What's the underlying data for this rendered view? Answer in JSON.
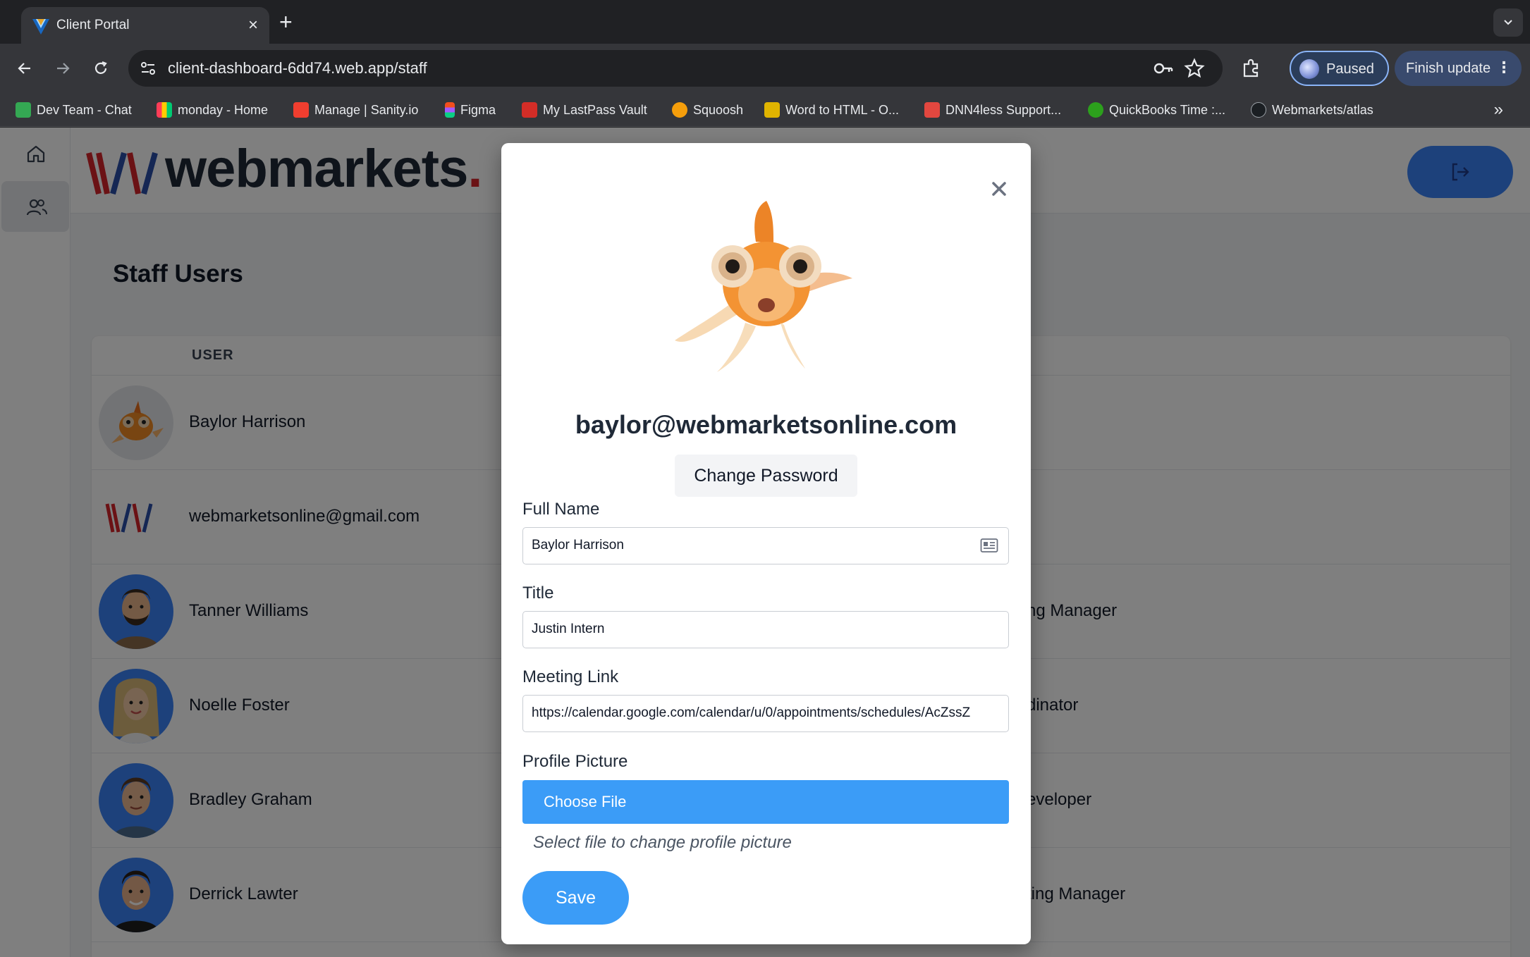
{
  "browser": {
    "tab_title": "Client Portal",
    "tab_close": "×",
    "new_tab": "+",
    "url": "client-dashboard-6dd74.web.app/staff",
    "profile_status": "Paused",
    "update_label": "Finish update",
    "update_menu": "⋮",
    "overflow": "»",
    "bookmarks": [
      {
        "label": "Dev Team - Chat",
        "color": "#34a853"
      },
      {
        "label": "monday - Home",
        "color": "#ff3d57"
      },
      {
        "label": "Manage | Sanity.io",
        "color": "#f03e2f"
      },
      {
        "label": "Figma",
        "color": "#a259ff"
      },
      {
        "label": "My LastPass Vault",
        "color": "#d32d27"
      },
      {
        "label": "Squoosh",
        "color": "#f59e0b"
      },
      {
        "label": "Word to HTML - O...",
        "color": "#e0b400"
      },
      {
        "label": "DNN4less Support...",
        "color": "#e2473f"
      },
      {
        "label": "QuickBooks Time :...",
        "color": "#2ca01c"
      },
      {
        "label": "Webmarkets/atlas",
        "color": "#1b1f23"
      }
    ]
  },
  "app": {
    "brand": "webmarkets",
    "brand_dot": ".",
    "page_title": "Staff Users",
    "table": {
      "column_user": "USER",
      "rows": [
        {
          "name": "Baylor Harrison",
          "title": "",
          "avatar": "goldfish"
        },
        {
          "name": "webmarketsonline@gmail.com",
          "title": "",
          "avatar": "logo"
        },
        {
          "name": "Tanner Williams",
          "title": "ng Manager",
          "avatar": "cartoon-beard"
        },
        {
          "name": "Noelle Foster",
          "title": "dinator",
          "avatar": "cartoon-blonde"
        },
        {
          "name": "Bradley Graham",
          "title": "eveloper",
          "avatar": "cartoon-brown"
        },
        {
          "name": "Derrick Lawter",
          "title": "ting Manager",
          "avatar": "cartoon-dark"
        }
      ]
    }
  },
  "modal": {
    "close_icon": "close-icon",
    "email": "baylor@webmarketsonline.com",
    "change_password": "Change Password",
    "full_name_label": "Full Name",
    "full_name_value": "Baylor Harrison",
    "title_label": "Title",
    "title_value": "Justin Intern",
    "meeting_link_label": "Meeting Link",
    "meeting_link_value": "https://calendar.google.com/calendar/u/0/appointments/schedules/AcZssZ",
    "profile_picture_label": "Profile Picture",
    "choose_file": "Choose File",
    "hint": "Select file to change profile picture",
    "save": "Save"
  },
  "colors": {
    "accent": "#3b9cf7",
    "logout": "#3b82f6",
    "brand_red": "#d6242b",
    "brand_blue": "#2b4fa8"
  }
}
